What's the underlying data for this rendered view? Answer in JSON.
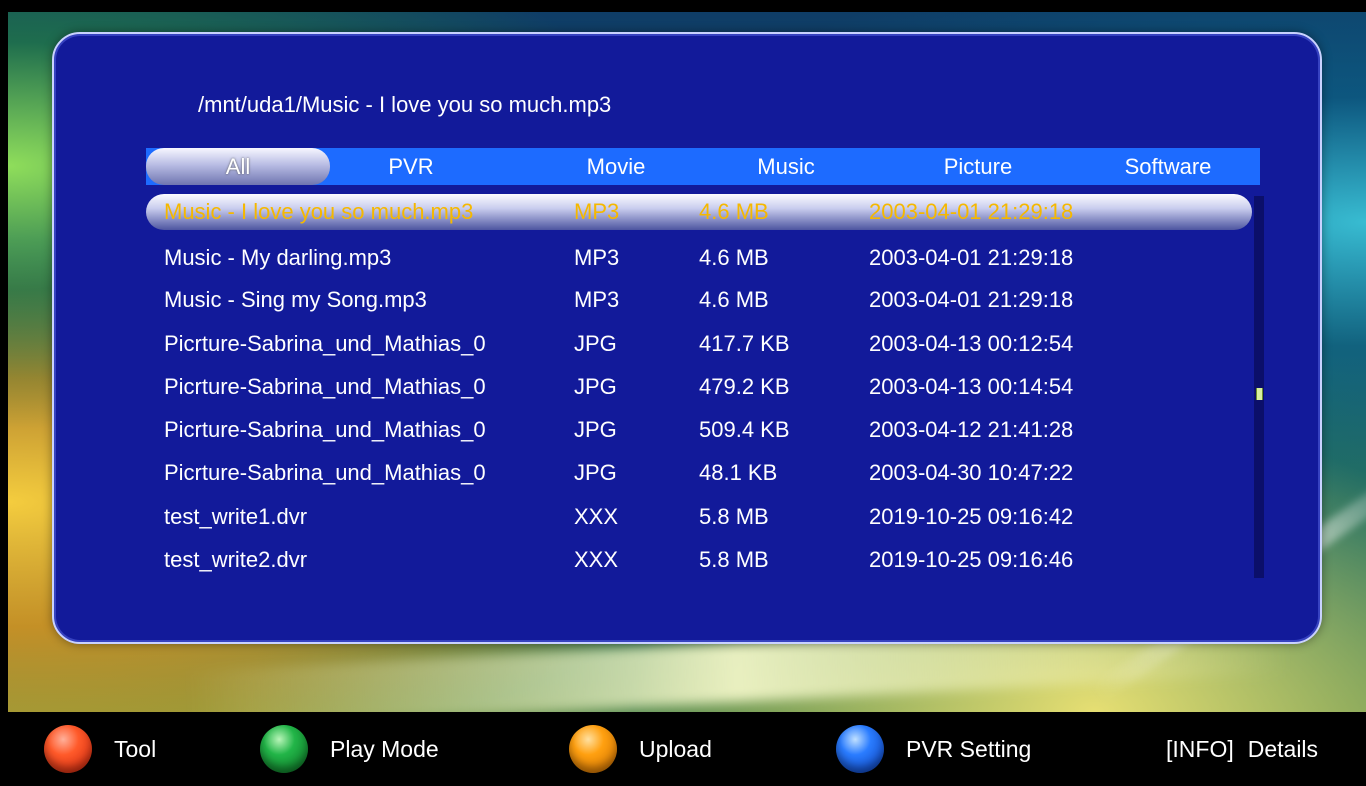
{
  "path": "/mnt/uda1/Music - I love you so much.mp3",
  "tabs": [
    {
      "label": "All",
      "active": true
    },
    {
      "label": "PVR",
      "active": false
    },
    {
      "label": "Movie",
      "active": false
    },
    {
      "label": "Music",
      "active": false
    },
    {
      "label": "Picture",
      "active": false
    },
    {
      "label": "Software",
      "active": false
    }
  ],
  "files": [
    {
      "name": "Music - I love you so much.mp3",
      "type": "MP3",
      "size": "4.6 MB",
      "date": "2003-04-01 21:29:18",
      "selected": true
    },
    {
      "name": "Music - My darling.mp3",
      "type": "MP3",
      "size": "4.6 MB",
      "date": "2003-04-01 21:29:18"
    },
    {
      "name": "Music - Sing my Song.mp3",
      "type": "MP3",
      "size": "4.6 MB",
      "date": "2003-04-01 21:29:18"
    },
    {
      "name": "Picrture-Sabrina_und_Mathias_0",
      "type": "JPG",
      "size": "417.7 KB",
      "date": "2003-04-13 00:12:54"
    },
    {
      "name": "Picrture-Sabrina_und_Mathias_0",
      "type": "JPG",
      "size": "479.2 KB",
      "date": "2003-04-13 00:14:54"
    },
    {
      "name": "Picrture-Sabrina_und_Mathias_0",
      "type": "JPG",
      "size": "509.4 KB",
      "date": "2003-04-12 21:41:28"
    },
    {
      "name": "Picrture-Sabrina_und_Mathias_0",
      "type": "JPG",
      "size": "48.1 KB",
      "date": "2003-04-30 10:47:22"
    },
    {
      "name": "test_write1.dvr",
      "type": "XXX",
      "size": "5.8 MB",
      "date": "2019-10-25 09:16:42"
    },
    {
      "name": "test_write2.dvr",
      "type": "XXX",
      "size": "5.8 MB",
      "date": "2019-10-25 09:16:46"
    }
  ],
  "footer": {
    "red": {
      "label": "Tool",
      "icon": "red-button-icon",
      "color": "#ff5a2a"
    },
    "green": {
      "label": "Play Mode",
      "icon": "green-button-icon",
      "color": "#22b548"
    },
    "orange": {
      "label": "Upload",
      "icon": "orange-button-icon",
      "color": "#ffa010"
    },
    "blue": {
      "label": "PVR Setting",
      "icon": "blue-button-icon",
      "color": "#2a7cff"
    },
    "info": {
      "key": "[INFO]",
      "label": "Details"
    }
  },
  "colors": {
    "panel": "#121a9a",
    "tab_bar": "#1d6bff",
    "selected_text": "#f5b800"
  }
}
